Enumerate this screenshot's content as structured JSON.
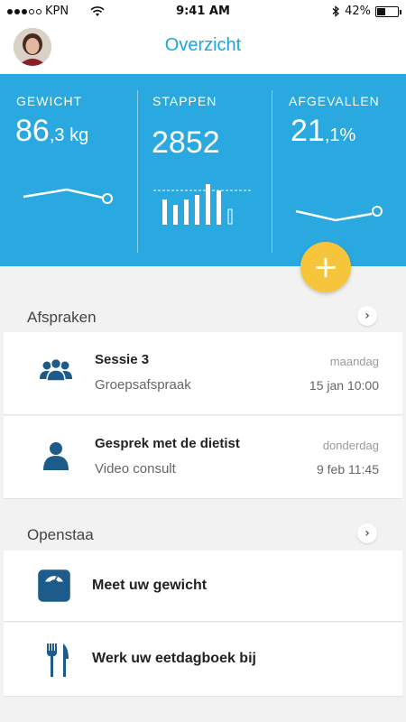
{
  "status_bar": {
    "carrier": "KPN",
    "time": "9:41 AM",
    "battery": "42%",
    "battery_level": 0.42
  },
  "header": {
    "title": "Overzicht"
  },
  "stats": [
    {
      "label": "GEWICHT",
      "value": "86",
      "unit": ",3 kg"
    },
    {
      "label": "STAPPEN",
      "value": "2852",
      "unit": ""
    },
    {
      "label": "AFGEVALLEN",
      "value": "21",
      "unit": ",1%"
    }
  ],
  "fab": {
    "label": "+"
  },
  "appointments": {
    "title": "Afspraken",
    "items": [
      {
        "title": "Sessie 3",
        "subtitle": "Groepsafspraak",
        "day": "maandag",
        "date": "15 jan 10:00",
        "icon": "group-icon"
      },
      {
        "title": "Gesprek met de dietist",
        "subtitle": "Video consult",
        "day": "donderdag",
        "date": "9 feb 11:45",
        "icon": "person-icon"
      }
    ]
  },
  "open": {
    "title": "Openstaa",
    "items": [
      {
        "title": "Meet uw gewicht",
        "icon": "scale-icon"
      },
      {
        "title": "Werk uw eetdagboek bij",
        "icon": "fork-knife-icon"
      }
    ]
  },
  "colors": {
    "accent": "#2aa9e0",
    "title": "#1aa7d8",
    "fab": "#f6c53c",
    "icon": "#1d5b8b"
  }
}
